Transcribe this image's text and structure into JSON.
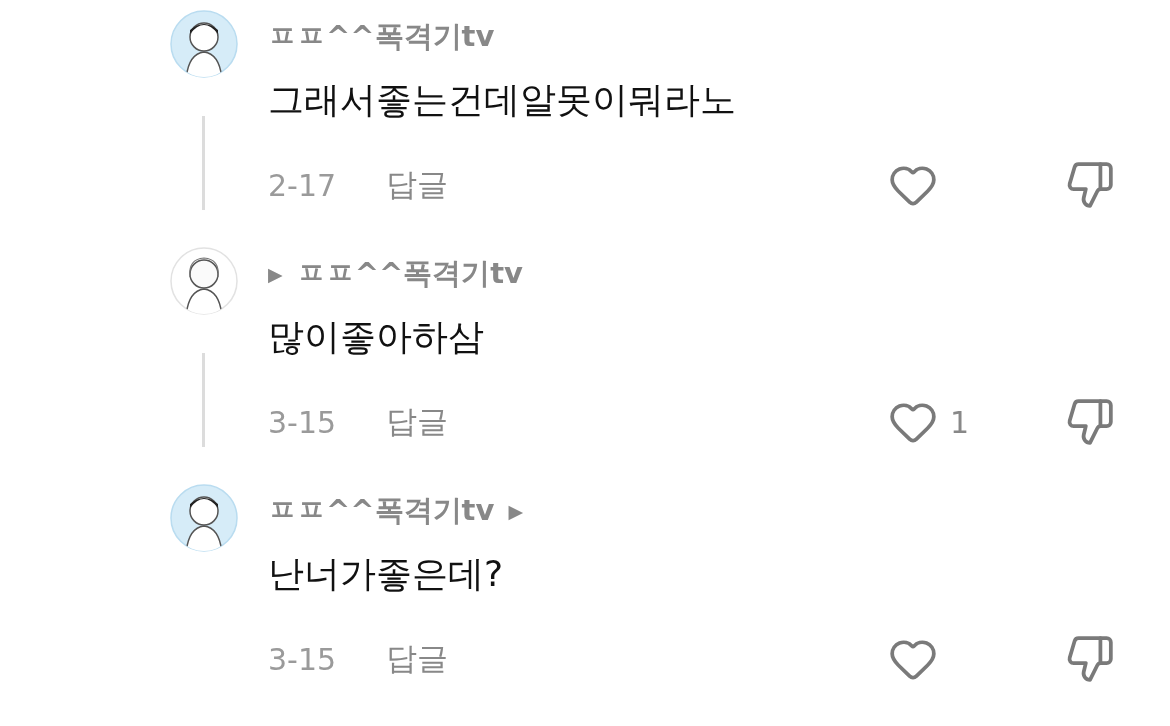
{
  "comments": [
    {
      "avatar": {
        "kind": "tinted"
      },
      "author": "ㅍㅍ^^폭격기tv",
      "text": "그래서좋는건데알못이뭐라노",
      "date": "2-17",
      "reply": "답글",
      "liked": false,
      "disliked": false,
      "thread_line": true
    },
    {
      "avatar": {
        "kind": "sketch"
      },
      "arrow_before": "▶",
      "author": "ㅍㅍ^^폭격기tv",
      "text": "많이좋아하삼",
      "date": "3-15",
      "reply": "답글",
      "liked": false,
      "likes": "1",
      "disliked": false,
      "thread_line": true
    },
    {
      "avatar": {
        "kind": "tinted"
      },
      "author": "ㅍㅍ^^폭격기tv",
      "arrow_after": "▶",
      "text": "난너가좋은데?",
      "date": "3-15",
      "reply": "답글",
      "liked": false,
      "disliked": false
    }
  ]
}
